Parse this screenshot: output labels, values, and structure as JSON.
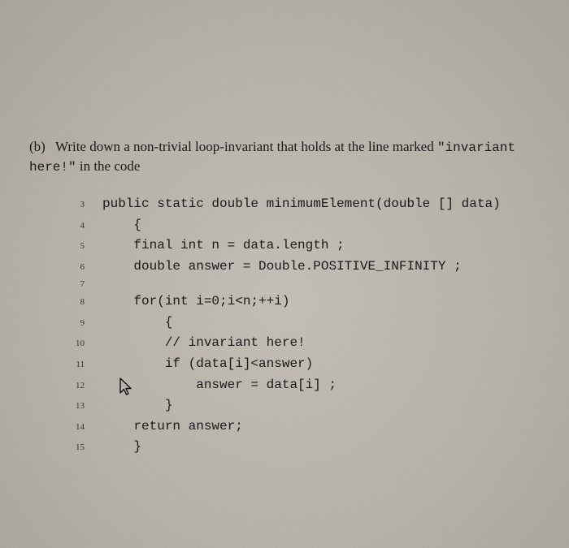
{
  "question": {
    "label": "(b)",
    "text_before": "Write down a non-trivial loop-invariant that holds at the line marked ",
    "code_phrase": "\"invariant here!\"",
    "text_after": " in the code"
  },
  "code": {
    "lines": [
      {
        "n": "3",
        "t": "public static double minimumElement(double [] data)"
      },
      {
        "n": "4",
        "t": "    {"
      },
      {
        "n": "5",
        "t": "    final int n = data.length ;"
      },
      {
        "n": "6",
        "t": "    double answer = Double.POSITIVE_INFINITY ;"
      },
      {
        "n": "7",
        "t": ""
      },
      {
        "n": "8",
        "t": "    for(int i=0;i<n;++i)"
      },
      {
        "n": "9",
        "t": "        {"
      },
      {
        "n": "10",
        "t": "        // invariant here!"
      },
      {
        "n": "11",
        "t": "        if (data[i]<answer)"
      },
      {
        "n": "12",
        "t": "            answer = data[i] ;"
      },
      {
        "n": "13",
        "t": "        }"
      },
      {
        "n": "14",
        "t": "    return answer;"
      },
      {
        "n": "15",
        "t": "    }"
      }
    ]
  }
}
